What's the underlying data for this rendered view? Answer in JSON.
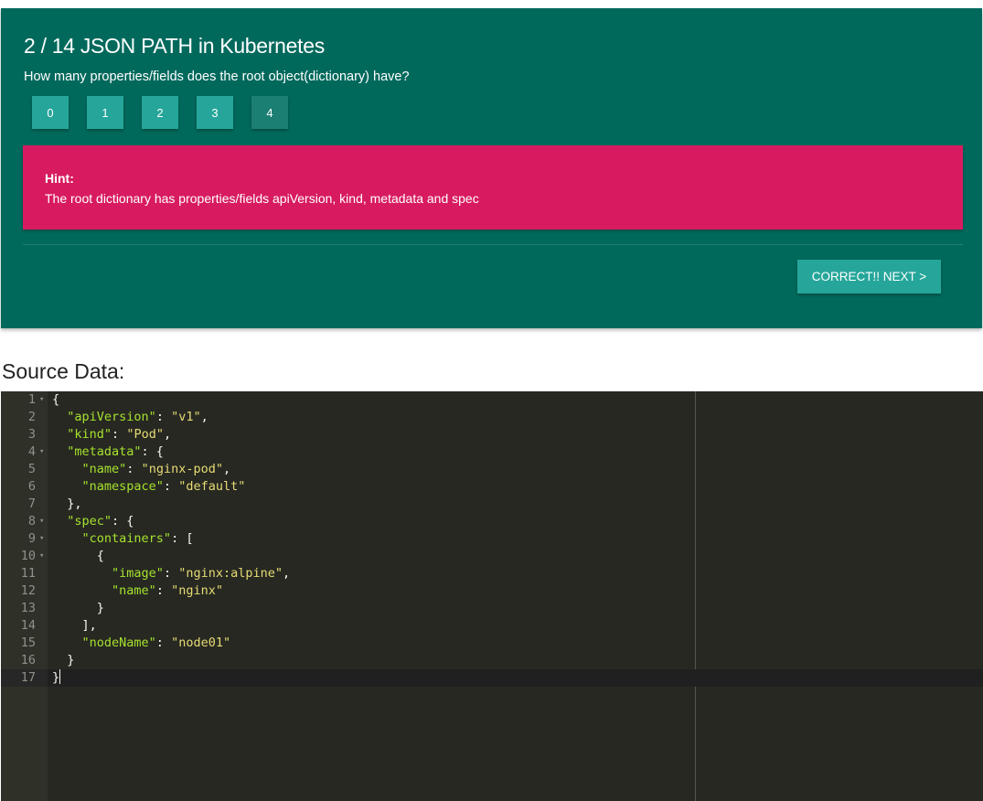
{
  "quiz": {
    "title": "2 / 14 JSON PATH in Kubernetes",
    "question": "How many properties/fields does the root object(dictionary) have?",
    "answers": [
      "0",
      "1",
      "2",
      "3",
      "4"
    ],
    "selected_answer": "4",
    "hint_label": "Hint:",
    "hint_text": "The root dictionary has properties/fields apiVersion, kind, metadata and spec",
    "next_button": "CORRECT!! NEXT >"
  },
  "source": {
    "heading": "Source Data:",
    "active_line": 17,
    "lines": [
      {
        "n": "1",
        "fold": true,
        "indent": "",
        "tokens": [
          [
            "p",
            "{"
          ]
        ]
      },
      {
        "n": "2",
        "fold": false,
        "indent": "  ",
        "tokens": [
          [
            "k",
            "\"apiVersion\""
          ],
          [
            "p",
            ": "
          ],
          [
            "s",
            "\"v1\""
          ],
          [
            "p",
            ","
          ]
        ]
      },
      {
        "n": "3",
        "fold": false,
        "indent": "  ",
        "tokens": [
          [
            "k",
            "\"kind\""
          ],
          [
            "p",
            ": "
          ],
          [
            "s",
            "\"Pod\""
          ],
          [
            "p",
            ","
          ]
        ]
      },
      {
        "n": "4",
        "fold": true,
        "indent": "  ",
        "tokens": [
          [
            "k",
            "\"metadata\""
          ],
          [
            "p",
            ": {"
          ]
        ]
      },
      {
        "n": "5",
        "fold": false,
        "indent": "    ",
        "tokens": [
          [
            "k",
            "\"name\""
          ],
          [
            "p",
            ": "
          ],
          [
            "s",
            "\"nginx-pod\""
          ],
          [
            "p",
            ","
          ]
        ]
      },
      {
        "n": "6",
        "fold": false,
        "indent": "    ",
        "tokens": [
          [
            "k",
            "\"namespace\""
          ],
          [
            "p",
            ": "
          ],
          [
            "s",
            "\"default\""
          ]
        ]
      },
      {
        "n": "7",
        "fold": false,
        "indent": "  ",
        "tokens": [
          [
            "p",
            "},"
          ]
        ]
      },
      {
        "n": "8",
        "fold": true,
        "indent": "  ",
        "tokens": [
          [
            "k",
            "\"spec\""
          ],
          [
            "p",
            ": {"
          ]
        ]
      },
      {
        "n": "9",
        "fold": true,
        "indent": "    ",
        "tokens": [
          [
            "k",
            "\"containers\""
          ],
          [
            "p",
            ": ["
          ]
        ]
      },
      {
        "n": "10",
        "fold": true,
        "indent": "      ",
        "tokens": [
          [
            "p",
            "{"
          ]
        ]
      },
      {
        "n": "11",
        "fold": false,
        "indent": "        ",
        "tokens": [
          [
            "k",
            "\"image\""
          ],
          [
            "p",
            ": "
          ],
          [
            "s",
            "\"nginx:alpine\""
          ],
          [
            "p",
            ","
          ]
        ]
      },
      {
        "n": "12",
        "fold": false,
        "indent": "        ",
        "tokens": [
          [
            "k",
            "\"name\""
          ],
          [
            "p",
            ": "
          ],
          [
            "s",
            "\"nginx\""
          ]
        ]
      },
      {
        "n": "13",
        "fold": false,
        "indent": "      ",
        "tokens": [
          [
            "p",
            "}"
          ]
        ]
      },
      {
        "n": "14",
        "fold": false,
        "indent": "    ",
        "tokens": [
          [
            "p",
            "],"
          ]
        ]
      },
      {
        "n": "15",
        "fold": false,
        "indent": "    ",
        "tokens": [
          [
            "k",
            "\"nodeName\""
          ],
          [
            "p",
            ": "
          ],
          [
            "s",
            "\"node01\""
          ]
        ]
      },
      {
        "n": "16",
        "fold": false,
        "indent": "  ",
        "tokens": [
          [
            "p",
            "}"
          ]
        ]
      },
      {
        "n": "17",
        "fold": false,
        "indent": "",
        "tokens": [
          [
            "p",
            "}"
          ]
        ]
      }
    ]
  }
}
